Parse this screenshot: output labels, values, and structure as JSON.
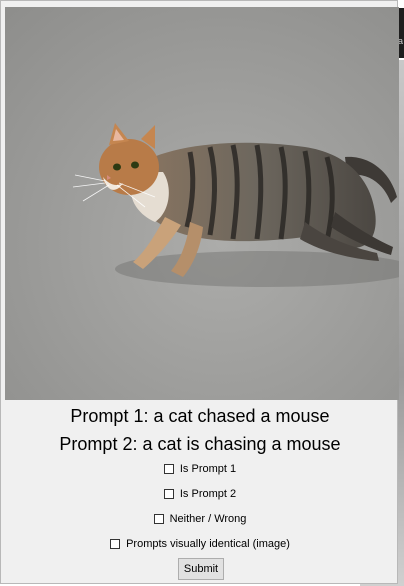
{
  "background": {
    "edge_text": "a"
  },
  "dialog": {
    "image": {
      "subject": "tabby cat running on gray carpet",
      "icon": "photo"
    },
    "prompt_1": "Prompt 1: a cat chased a mouse",
    "prompt_2": "Prompt 2: a cat is chasing a mouse",
    "options": [
      {
        "label": "Is Prompt 1",
        "checked": false
      },
      {
        "label": "Is Prompt 2",
        "checked": false
      },
      {
        "label": "Neither / Wrong",
        "checked": false
      },
      {
        "label": "Prompts visually identical (image)",
        "checked": false
      }
    ],
    "submit_label": "Submit"
  }
}
